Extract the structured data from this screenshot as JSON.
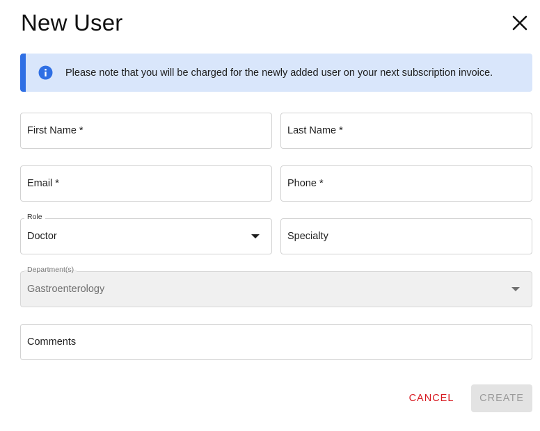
{
  "dialog": {
    "title": "New User"
  },
  "notice": {
    "text": "Please note that you will be charged for the newly added user on your next subscription invoice.",
    "accent_color": "#2f6fe4",
    "background_color": "#d9e6fb",
    "icon": "info-icon"
  },
  "form": {
    "first_name": {
      "placeholder": "First Name *",
      "value": ""
    },
    "last_name": {
      "placeholder": "Last Name *",
      "value": ""
    },
    "email": {
      "placeholder": "Email *",
      "value": ""
    },
    "phone": {
      "placeholder": "Phone *",
      "value": ""
    },
    "role": {
      "label": "Role",
      "value": "Doctor"
    },
    "specialty": {
      "placeholder": "Specialty",
      "value": ""
    },
    "department": {
      "label": "Department(s)",
      "value": "Gastroenterology",
      "disabled": true
    },
    "comments": {
      "placeholder": "Comments",
      "value": ""
    }
  },
  "actions": {
    "cancel_label": "CANCEL",
    "create_label": "CREATE",
    "cancel_color": "#d71920",
    "create_disabled": true
  }
}
